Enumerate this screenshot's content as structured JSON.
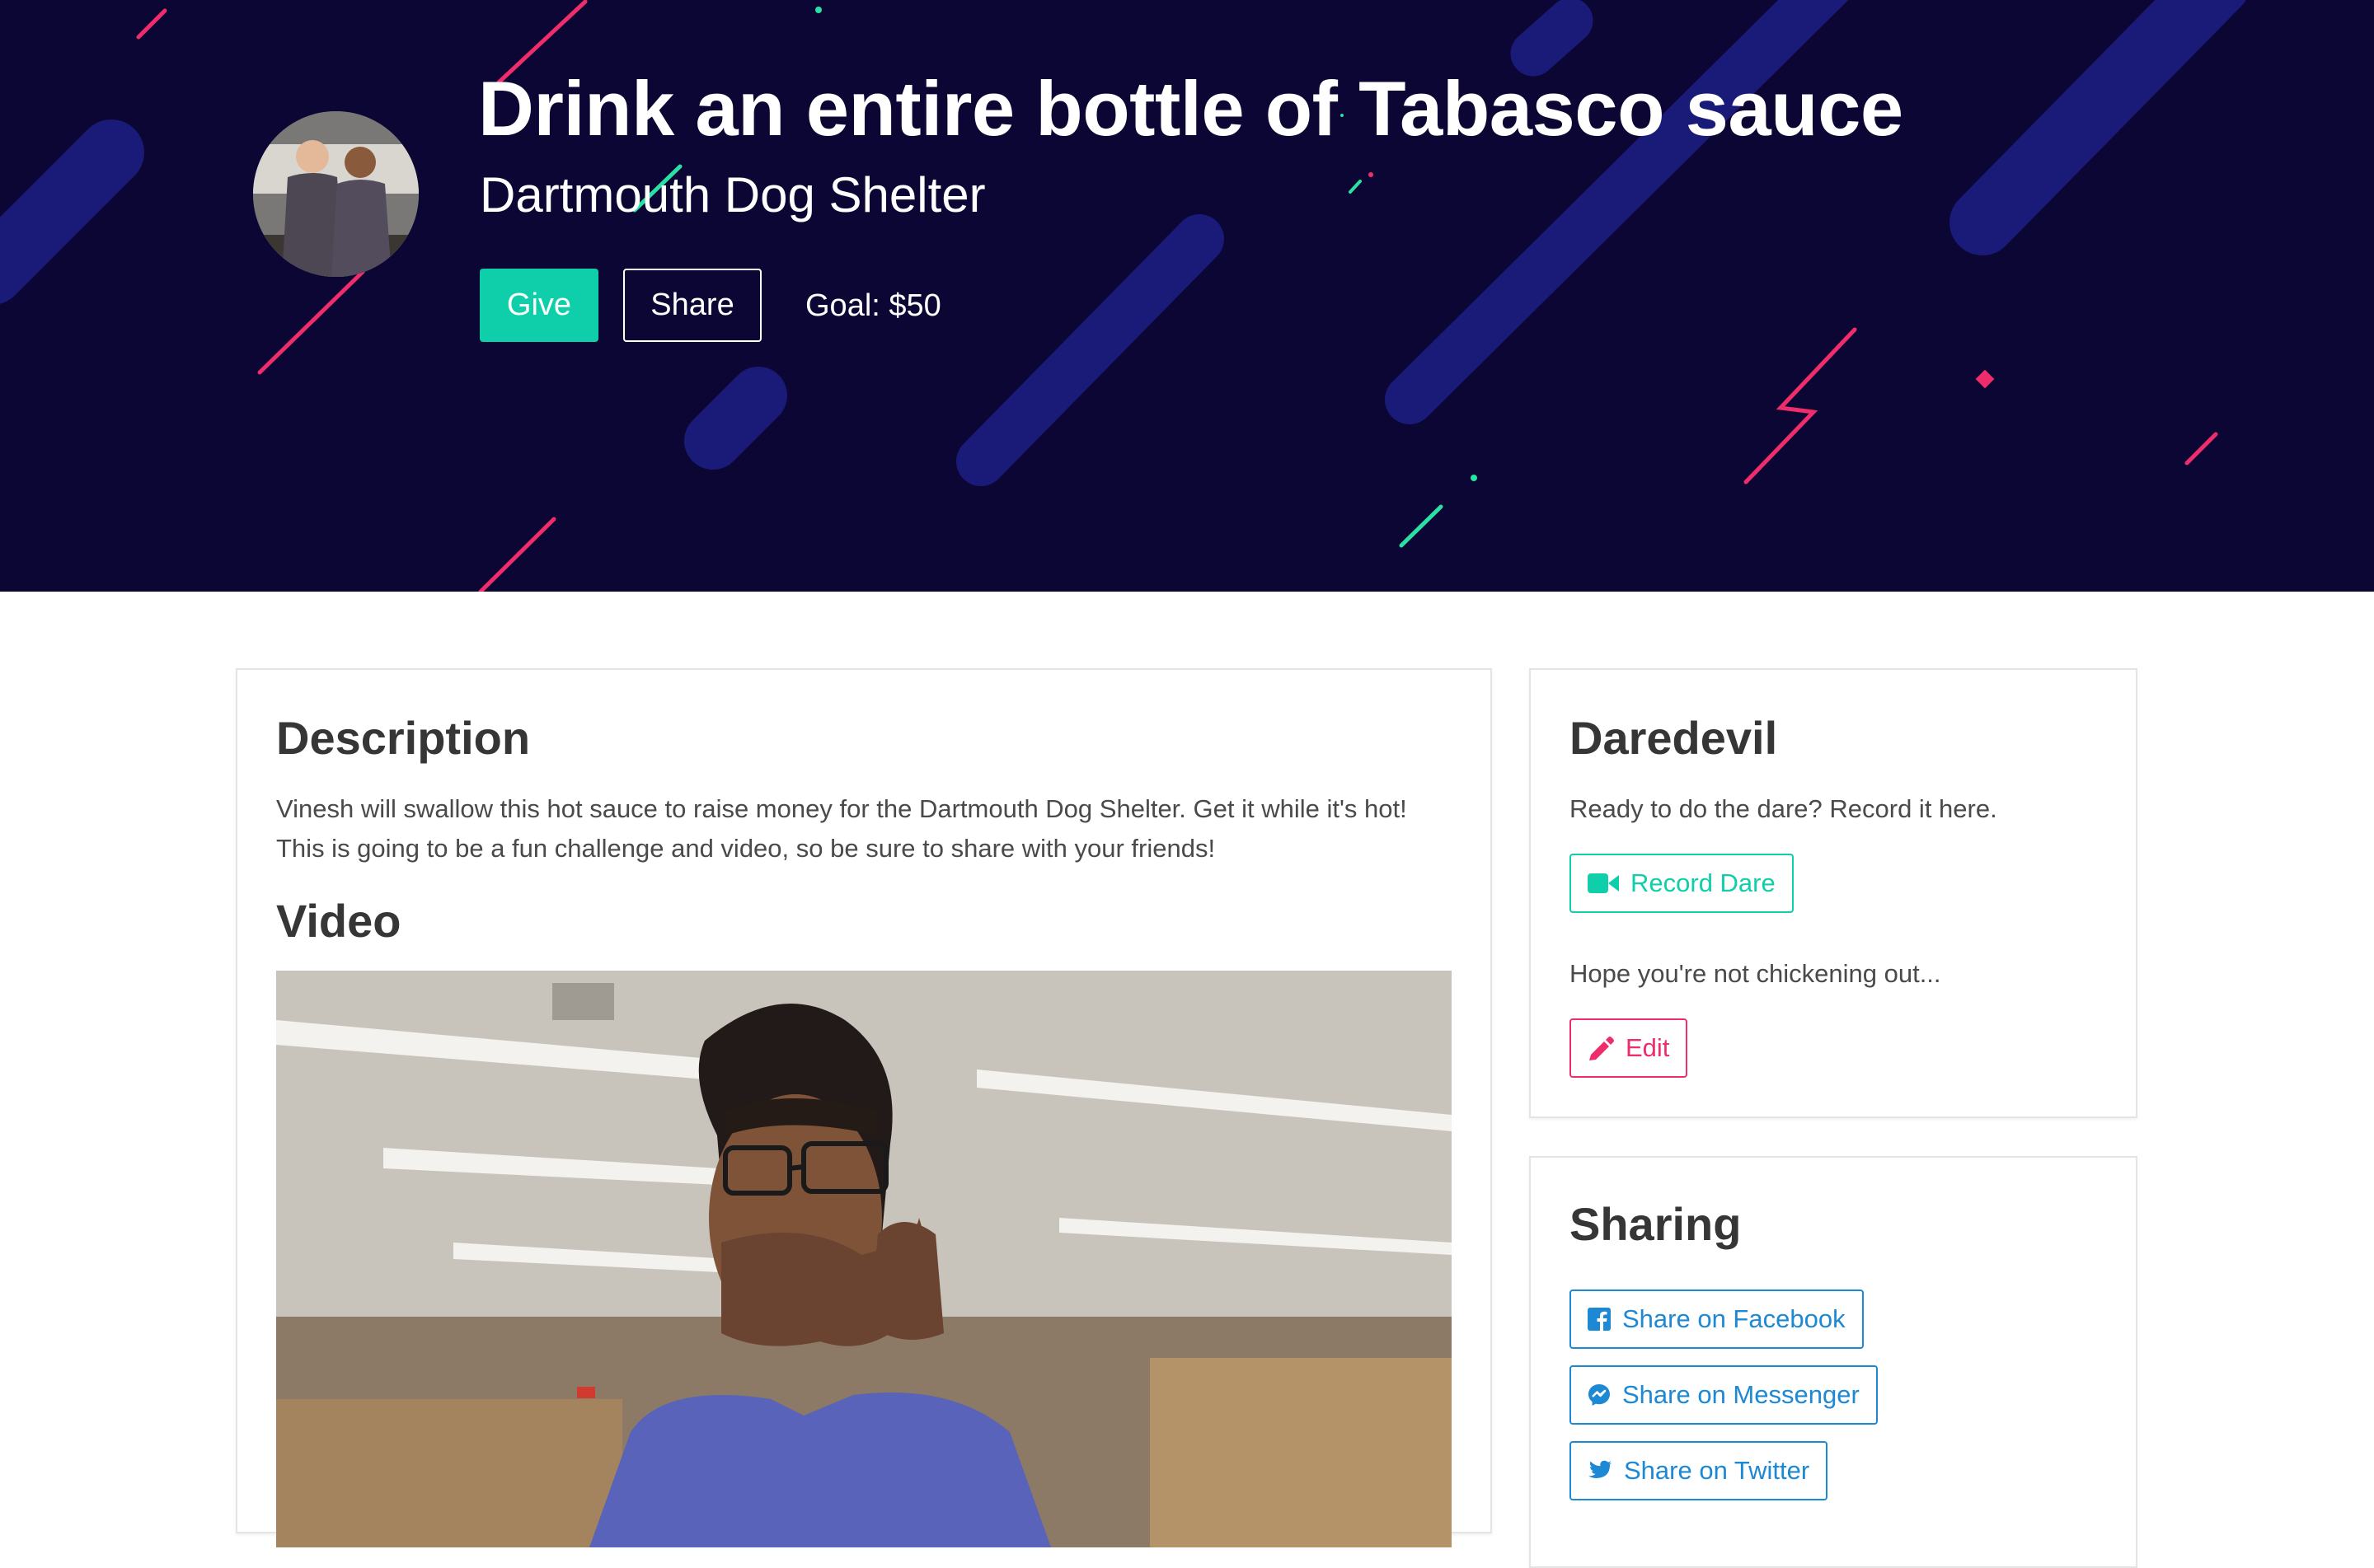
{
  "hero": {
    "title": "Drink an entire bottle of Tabasco sauce",
    "charity": "Dartmouth Dog Shelter",
    "give_label": "Give",
    "share_label": "Share",
    "goal_text": "Goal: $50",
    "avatar_icon": "team-photo",
    "background_color": "#0c0634"
  },
  "description": {
    "heading": "Description",
    "text": "Vinesh will swallow this hot sauce to raise money for the Dartmouth Dog Shelter. Get it while it's hot! This is going to be a fun challenge and video, so be sure to share with your friends!"
  },
  "video": {
    "heading": "Video",
    "media_icon": "video-player"
  },
  "daredevil": {
    "heading": "Daredevil",
    "prompt": "Ready to do the dare? Record it here.",
    "record_label": "Record Dare",
    "record_icon": "video-camera-icon",
    "note": "Hope you're not chickening out...",
    "edit_label": "Edit",
    "edit_icon": "pencil-icon"
  },
  "sharing": {
    "heading": "Sharing",
    "buttons": [
      {
        "label": "Share on Facebook",
        "icon": "facebook-icon"
      },
      {
        "label": "Share on Messenger",
        "icon": "messenger-icon"
      },
      {
        "label": "Share on Twitter",
        "icon": "twitter-icon"
      }
    ]
  },
  "colors": {
    "accent_teal": "#0fcfaa",
    "accent_pink": "#f02d6b",
    "link_blue": "#1d88d4"
  }
}
